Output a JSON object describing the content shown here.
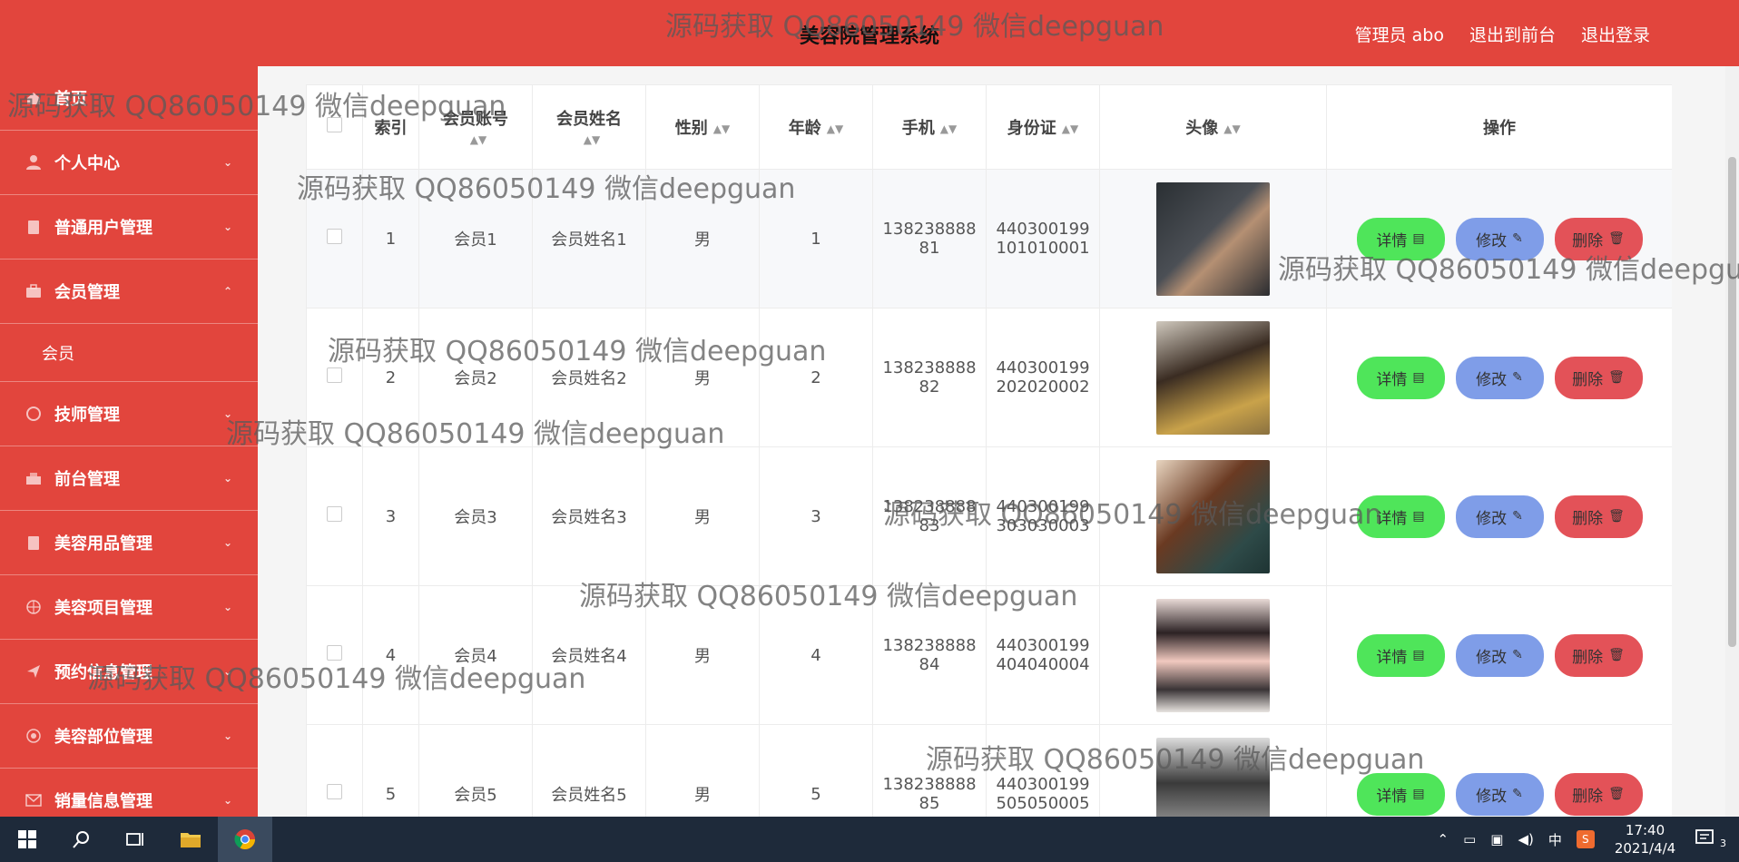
{
  "header": {
    "title": "美容院管理系统",
    "admin_label": "管理员 abo",
    "frontend_label": "退出到前台",
    "logout_label": "退出登录"
  },
  "sidebar": {
    "home": "首页",
    "items": [
      {
        "label": "个人中心",
        "icon": "user-icon"
      },
      {
        "label": "普通用户管理",
        "icon": "clipboard-icon"
      },
      {
        "label": "会员管理",
        "icon": "briefcase-icon"
      },
      {
        "label": "技师管理",
        "icon": "technician-icon"
      },
      {
        "label": "前台管理",
        "icon": "desk-icon"
      },
      {
        "label": "美容用品管理",
        "icon": "clipboard-icon"
      },
      {
        "label": "美容项目管理",
        "icon": "globe-icon"
      },
      {
        "label": "预约信息管理",
        "icon": "send-icon"
      },
      {
        "label": "美容部位管理",
        "icon": "target-icon"
      },
      {
        "label": "销量信息管理",
        "icon": "mail-icon"
      }
    ],
    "member_sub": "会员"
  },
  "table": {
    "headers": [
      "索引",
      "会员账号",
      "会员姓名",
      "性别",
      "年龄",
      "手机",
      "身份证",
      "头像",
      "操作"
    ],
    "rows": [
      {
        "index": "1",
        "account": "会员1",
        "name": "会员姓名1",
        "gender": "男",
        "age": "1",
        "phone": [
          "138238888",
          "81"
        ],
        "id_card": [
          "440300199",
          "101010001"
        ]
      },
      {
        "index": "2",
        "account": "会员2",
        "name": "会员姓名2",
        "gender": "男",
        "age": "2",
        "phone": [
          "138238888",
          "82"
        ],
        "id_card": [
          "440300199",
          "202020002"
        ]
      },
      {
        "index": "3",
        "account": "会员3",
        "name": "会员姓名3",
        "gender": "男",
        "age": "3",
        "phone": [
          "138238888",
          "83"
        ],
        "id_card": [
          "440300199",
          "303030003"
        ]
      },
      {
        "index": "4",
        "account": "会员4",
        "name": "会员姓名4",
        "gender": "男",
        "age": "4",
        "phone": [
          "138238888",
          "84"
        ],
        "id_card": [
          "440300199",
          "404040004"
        ]
      },
      {
        "index": "5",
        "account": "会员5",
        "name": "会员姓名5",
        "gender": "男",
        "age": "5",
        "phone": [
          "138238888",
          "85"
        ],
        "id_card": [
          "440300199",
          "505050005"
        ]
      }
    ],
    "actions": {
      "detail": "详情",
      "edit": "修改",
      "delete": "删除"
    }
  },
  "watermark": "源码获取 QQ86050149 微信deepguan",
  "taskbar": {
    "ime": "中",
    "time": "17:40",
    "date": "2021/4/4",
    "notifications": "3"
  },
  "colors": {
    "primary_red": "#e2453d",
    "detail_green": "#4fe55a",
    "edit_blue": "#7f9de8",
    "delete_red": "#e35258"
  }
}
